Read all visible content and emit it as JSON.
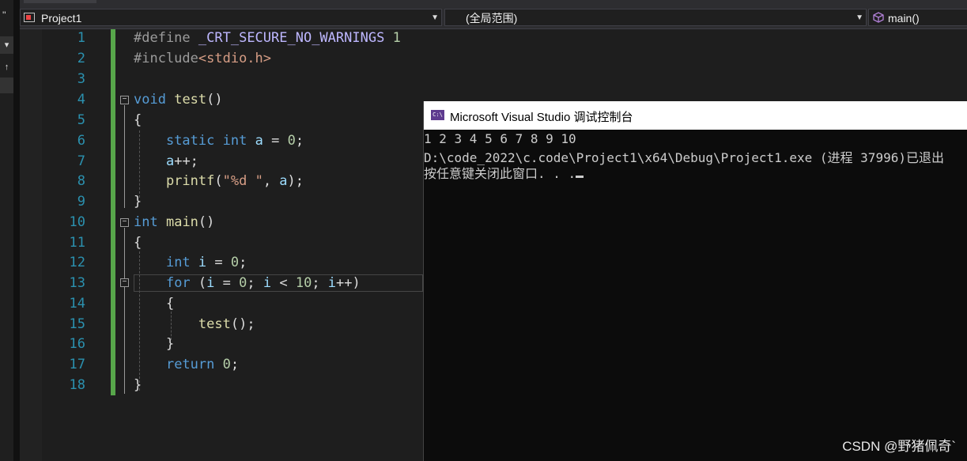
{
  "nav": {
    "project": "Project1",
    "scope": "(全局范围)",
    "member": "main()"
  },
  "editor": {
    "line_numbers": [
      "1",
      "2",
      "3",
      "4",
      "5",
      "6",
      "7",
      "8",
      "9",
      "10",
      "11",
      "12",
      "13",
      "14",
      "15",
      "16",
      "17",
      "18"
    ]
  },
  "console": {
    "title": "Microsoft Visual Studio 调试控制台",
    "icon_text": "C:\\",
    "lines": [
      "1 2 3 4 5 6 7 8 9 10",
      "D:\\code_2022\\c.code\\Project1\\x64\\Debug\\Project1.exe (进程 37996)已退出",
      "按任意键关闭此窗口. . ."
    ]
  },
  "watermark": "CSDN @野猪佩奇`",
  "colors": {
    "keyword": "#569cd6",
    "line_number": "#2b91af",
    "change_bar": "#57a64a",
    "console_bg": "#0c0c0c"
  }
}
